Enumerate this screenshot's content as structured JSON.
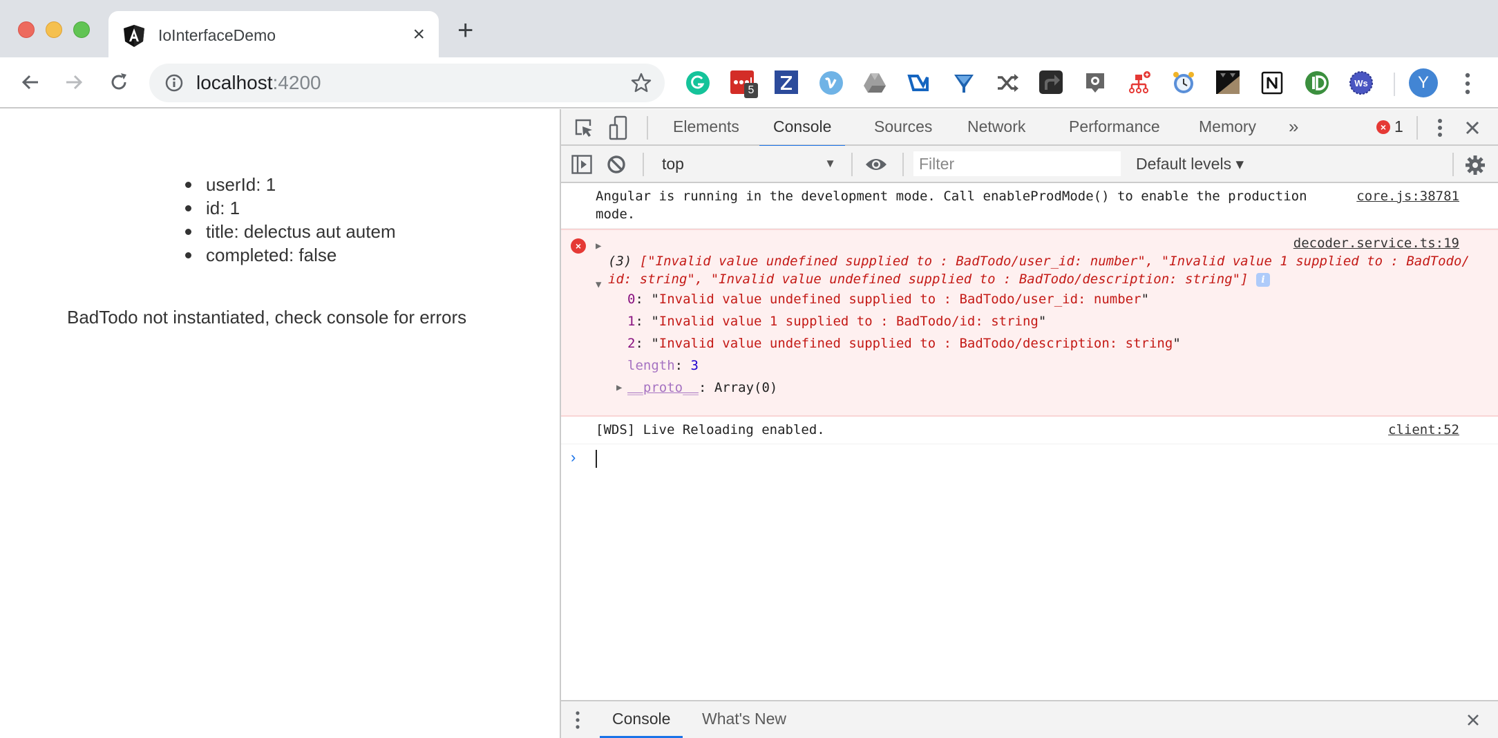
{
  "browser": {
    "tab": {
      "title": "IoInterfaceDemo",
      "favicon": "angular-icon"
    },
    "new_tab_label": "+",
    "address": {
      "host": "localhost",
      "port": ":4200"
    },
    "extensions": [
      "grammarly-icon",
      "lastpass-icon",
      "zotero-icon",
      "vimeo-icon",
      "google-drive-icon",
      "wappalyzer-icon",
      "yslow-icon",
      "shuffle-icon",
      "share-icon",
      "octotree-icon",
      "sitemap-icon",
      "alarm-clock-icon",
      "dark-reader-icon",
      "notion-icon",
      "identity-icon",
      "websocket-icon"
    ],
    "lastpass_badge": "5",
    "avatar_initial": "Y"
  },
  "page": {
    "todo_fields": [
      "userId: 1",
      "id: 1",
      "title: delectus aut autem",
      "completed: false"
    ],
    "message": "BadTodo not instantiated, check console for errors"
  },
  "devtools": {
    "tabs": [
      "Elements",
      "Console",
      "Sources",
      "Network",
      "Performance",
      "Memory"
    ],
    "active_tab": "Console",
    "more_tabs": "»",
    "error_count": "1",
    "context": "top",
    "filter_placeholder": "Filter",
    "levels": "Default levels ▾",
    "messages": {
      "log1": {
        "text": "Angular is running in the development mode. Call enableProdMode() to enable the production mode.",
        "source": "core.js:38781"
      },
      "error": {
        "source": "decoder.service.ts:19",
        "summary_count": "(3)",
        "summary": "[\"Invalid value undefined supplied to : BadTodo/user_id: number\", \"Invalid value 1 supplied to : BadTodo/id: string\", \"Invalid value undefined supplied to : BadTodo/description: string\"]",
        "items": [
          {
            "index": "0",
            "value": "Invalid value undefined supplied to : BadTodo/user_id: number"
          },
          {
            "index": "1",
            "value": "Invalid value 1 supplied to : BadTodo/id: string"
          },
          {
            "index": "2",
            "value": "Invalid value undefined supplied to : BadTodo/description: string"
          }
        ],
        "length_key": "length",
        "length_val": "3",
        "proto_key": "__proto__",
        "proto_val": ": Array(0)"
      },
      "log2": {
        "text": "[WDS] Live Reloading enabled.",
        "source": "client:52"
      }
    },
    "drawer": {
      "tabs": [
        "Console",
        "What's New"
      ],
      "active_tab": "Console"
    }
  }
}
